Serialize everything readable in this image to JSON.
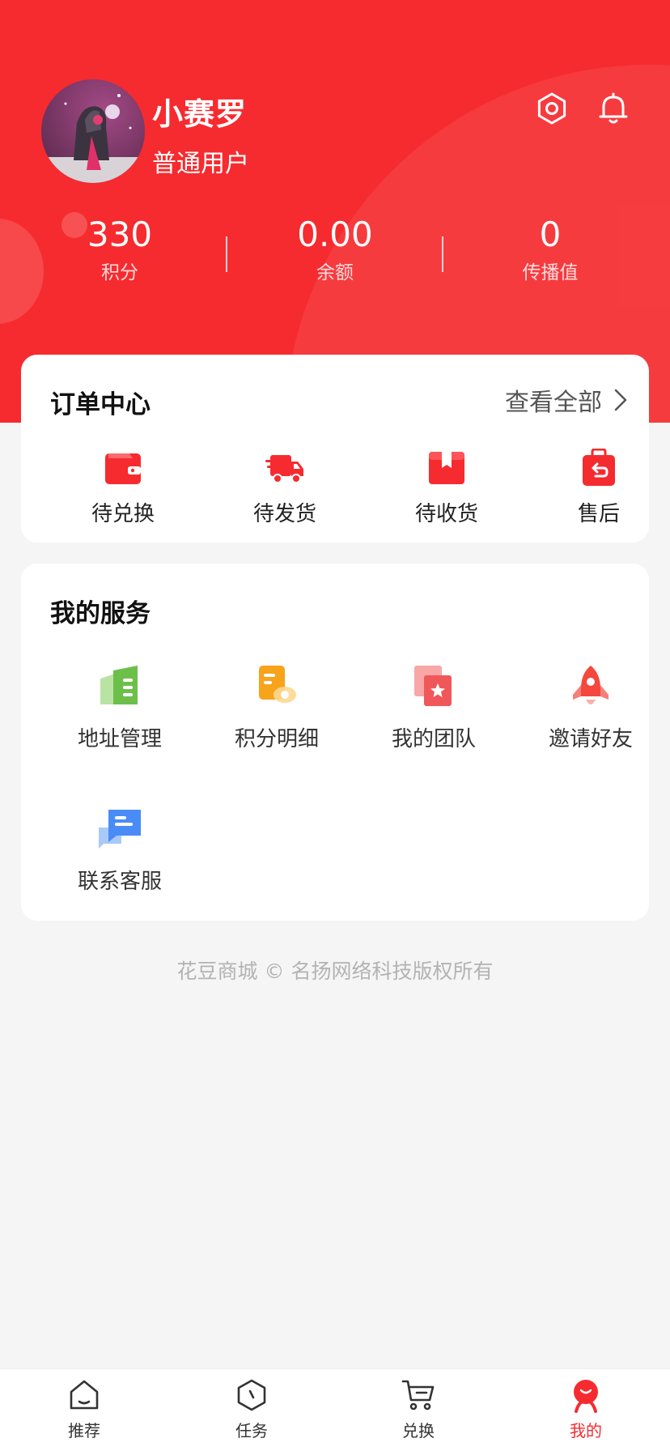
{
  "user": {
    "name": "小赛罗",
    "level": "普通用户"
  },
  "header": {
    "icons": [
      "gear-icon",
      "bell-icon"
    ],
    "brand_color": "#f62b2f"
  },
  "stats": [
    {
      "value": "330",
      "label": "积分"
    },
    {
      "value": "0.00",
      "label": "余额"
    },
    {
      "value": "0",
      "label": "传播值"
    }
  ],
  "orders": {
    "title": "订单中心",
    "view_all": "查看全部",
    "items": [
      {
        "label": "待兑换",
        "icon": "wallet-icon"
      },
      {
        "label": "待发货",
        "icon": "delivery-truck-icon"
      },
      {
        "label": "待收货",
        "icon": "package-box-icon"
      },
      {
        "label": "售后",
        "icon": "return-bag-icon"
      }
    ]
  },
  "services": {
    "title": "我的服务",
    "items": [
      {
        "label": "地址管理",
        "icon": "address-book-icon",
        "color": "#6cc04a"
      },
      {
        "label": "积分明细",
        "icon": "points-detail-icon",
        "color": "#f7a31c"
      },
      {
        "label": "我的团队",
        "icon": "team-icon",
        "color": "#f0575a"
      },
      {
        "label": "邀请好友",
        "icon": "rocket-icon",
        "color": "#f4473e"
      },
      {
        "label": "联系客服",
        "icon": "chat-bubble-icon",
        "color": "#4a8cf6"
      }
    ]
  },
  "footer": {
    "copyright": "花豆商城 © 名扬网络科技版权所有"
  },
  "tabbar": {
    "active_tab": "我的",
    "items": [
      {
        "label": "推荐",
        "icon": "home-icon"
      },
      {
        "label": "任务",
        "icon": "task-hexagon-icon"
      },
      {
        "label": "兑换",
        "icon": "cart-icon"
      },
      {
        "label": "我的",
        "icon": "profile-mascot-icon"
      }
    ]
  }
}
